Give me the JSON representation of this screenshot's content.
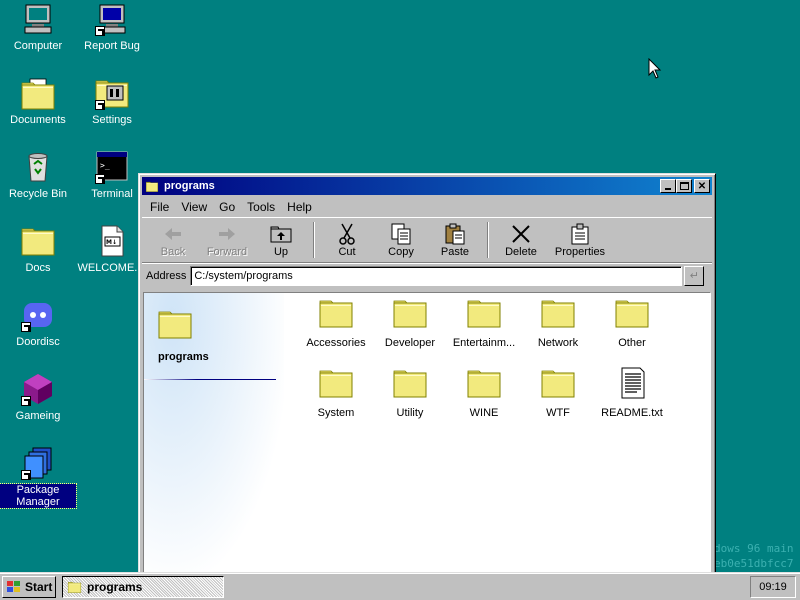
{
  "desktop": {
    "icons": [
      {
        "label": "Computer",
        "icon": "computer-icon"
      },
      {
        "label": "Report Bug",
        "icon": "report-bug-icon"
      },
      {
        "label": "Documents",
        "icon": "documents-folder-icon"
      },
      {
        "label": "Settings",
        "icon": "settings-icon"
      },
      {
        "label": "Recycle Bin",
        "icon": "recycle-bin-icon"
      },
      {
        "label": "Terminal",
        "icon": "terminal-icon"
      },
      {
        "label": "Docs",
        "icon": "folder-icon"
      },
      {
        "label": "WELCOME....",
        "icon": "markdown-file-icon"
      },
      {
        "label": "Doordisc",
        "icon": "doordisc-icon"
      },
      {
        "label": "Gameing",
        "icon": "gameing-icon"
      },
      {
        "label": "Package Manager",
        "icon": "package-manager-icon",
        "selected": true
      }
    ],
    "watermark_lines": [
      "dows 96 main",
      "eb0e51dbfcc7"
    ]
  },
  "window": {
    "title": "programs",
    "menu": [
      "File",
      "View",
      "Go",
      "Tools",
      "Help"
    ],
    "toolbar": {
      "back": "Back",
      "forward": "Forward",
      "up": "Up",
      "cut": "Cut",
      "copy": "Copy",
      "paste": "Paste",
      "delete": "Delete",
      "properties": "Properties"
    },
    "address": {
      "label": "Address",
      "value": "C:/system/programs"
    },
    "sidepanel_title": "programs",
    "items": [
      {
        "label": "Accessories",
        "type": "folder"
      },
      {
        "label": "Developer",
        "type": "folder"
      },
      {
        "label": "Entertainm...",
        "type": "folder"
      },
      {
        "label": "Network",
        "type": "folder"
      },
      {
        "label": "Other",
        "type": "folder"
      },
      {
        "label": "System",
        "type": "folder"
      },
      {
        "label": "Utility",
        "type": "folder"
      },
      {
        "label": "WINE",
        "type": "folder"
      },
      {
        "label": "WTF",
        "type": "folder"
      },
      {
        "label": "README.txt",
        "type": "text-file"
      }
    ]
  },
  "taskbar": {
    "start_label": "Start",
    "task_label": "programs",
    "clock": "09:19"
  },
  "colors": {
    "desktop": "#008080",
    "titlebar_start": "#000080",
    "titlebar_end": "#1084d0",
    "folder": "#f2ea7e"
  }
}
